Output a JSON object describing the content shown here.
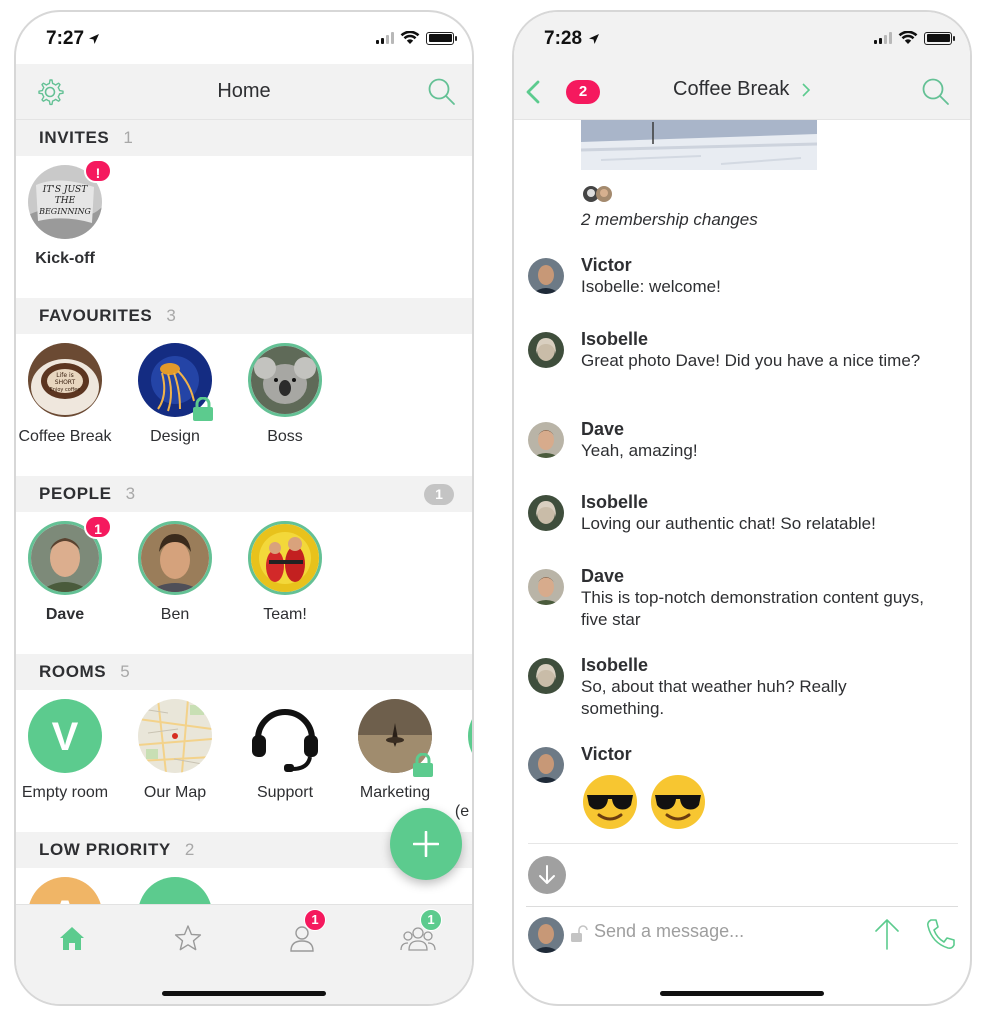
{
  "left": {
    "status": {
      "time": "7:27"
    },
    "header": {
      "title": "Home",
      "settings_icon": "gear-icon",
      "search_icon": "search-icon"
    },
    "sections": {
      "invites": {
        "title": "INVITES",
        "count": "1"
      },
      "favourites": {
        "title": "FAVOURITES",
        "count": "3"
      },
      "people": {
        "title": "PEOPLE",
        "count": "3",
        "unread": "1"
      },
      "rooms": {
        "title": "ROOMS",
        "count": "5"
      },
      "low_priority": {
        "title": "LOW PRIORITY",
        "count": "2"
      }
    },
    "invites": [
      {
        "label": "Kick-off",
        "badge": "!",
        "image_text": "IT'S JUST THE BEGINNING"
      }
    ],
    "favourites": [
      {
        "label": "Coffee Break",
        "image_text": "Life is SHORT Enjoy coffee"
      },
      {
        "label": "Design"
      },
      {
        "label": "Boss"
      }
    ],
    "people": [
      {
        "label": "Dave",
        "badge": "1"
      },
      {
        "label": "Ben"
      },
      {
        "label": "Team!"
      }
    ],
    "rooms": [
      {
        "label": "Empty room",
        "letter": "V"
      },
      {
        "label": "Our Map"
      },
      {
        "label": "Support"
      },
      {
        "label": "Marketing"
      },
      {
        "label": "(e"
      }
    ],
    "low_priority_letters": [
      "A"
    ],
    "tabbar": {
      "people_badge": "1",
      "rooms_badge": "1"
    },
    "colors": {
      "accent": "#5ccb8e",
      "badge": "#f5195e",
      "header_bg": "#f2f2f2"
    }
  },
  "right": {
    "status": {
      "time": "7:28"
    },
    "header": {
      "title": "Coffee Break",
      "unread_badge": "2"
    },
    "membership": "2 membership changes",
    "messages": [
      {
        "sender": "Victor",
        "text": "Isobelle: welcome!"
      },
      {
        "sender": "Isobelle",
        "text": "Great photo Dave! Did you have a nice time?"
      },
      {
        "sender": "Dave",
        "text": "Yeah, amazing!"
      },
      {
        "sender": "Isobelle",
        "text": "Loving our authentic chat! So relatable!"
      },
      {
        "sender": "Dave",
        "text": "This is top-notch demonstration content guys, five star"
      },
      {
        "sender": "Isobelle",
        "text": "So, about that weather huh? Really something."
      },
      {
        "sender": "Victor",
        "emojis": [
          "😎",
          "😎"
        ]
      }
    ],
    "composer": {
      "placeholder": "Send a message..."
    }
  }
}
